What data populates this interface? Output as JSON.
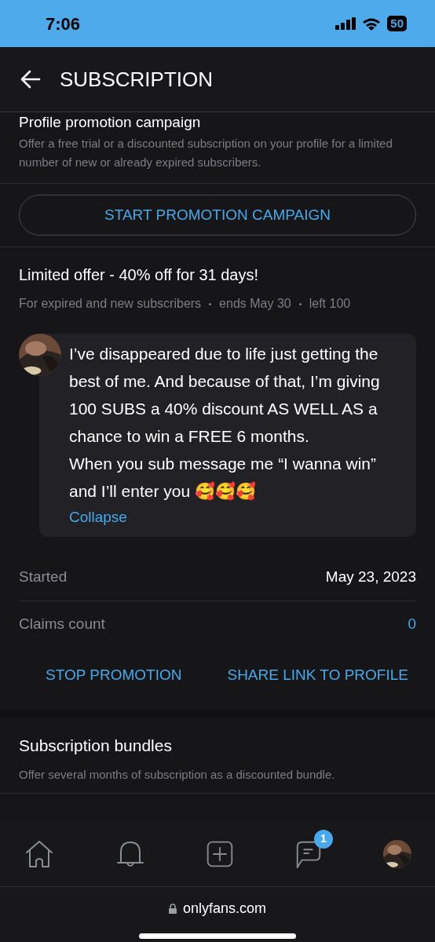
{
  "status_bar": {
    "time": "7:06",
    "battery": "50"
  },
  "header": {
    "title": "SUBSCRIPTION"
  },
  "promotion_section": {
    "title": "Profile promotion campaign",
    "description": "Offer a free trial or a discounted subscription on your profile for a limited number of new or already expired subscribers.",
    "button": "START PROMOTION CAMPAIGN"
  },
  "offer": {
    "title": "Limited offer - 40% off for 31 days!",
    "meta": [
      "For expired and new subscribers",
      "ends May 30",
      "left 100"
    ],
    "message": {
      "lines": [
        "I’ve disappeared due to life just getting the best of me. And because of that, I’m giving 100 SUBS a 40% discount AS WELL AS a chance to win a FREE 6 months.",
        "When you sub message me “I wanna win” and I’ll enter you 🥰🥰🥰"
      ],
      "collapse": "Collapse"
    },
    "details": [
      {
        "label": "Started",
        "value": "May 23, 2023",
        "link": false
      },
      {
        "label": "Claims count",
        "value": "0",
        "link": true
      }
    ],
    "actions": [
      "STOP PROMOTION",
      "SHARE LINK TO PROFILE"
    ]
  },
  "bundles": {
    "title": "Subscription bundles",
    "description": "Offer several months of subscription as a discounted bundle."
  },
  "bottom_nav": [
    {
      "kind": "home"
    },
    {
      "kind": "bell"
    },
    {
      "kind": "plus"
    },
    {
      "kind": "chat",
      "badge": "1"
    },
    {
      "kind": "avatar"
    }
  ],
  "browser": {
    "url": "onlyfans.com"
  }
}
